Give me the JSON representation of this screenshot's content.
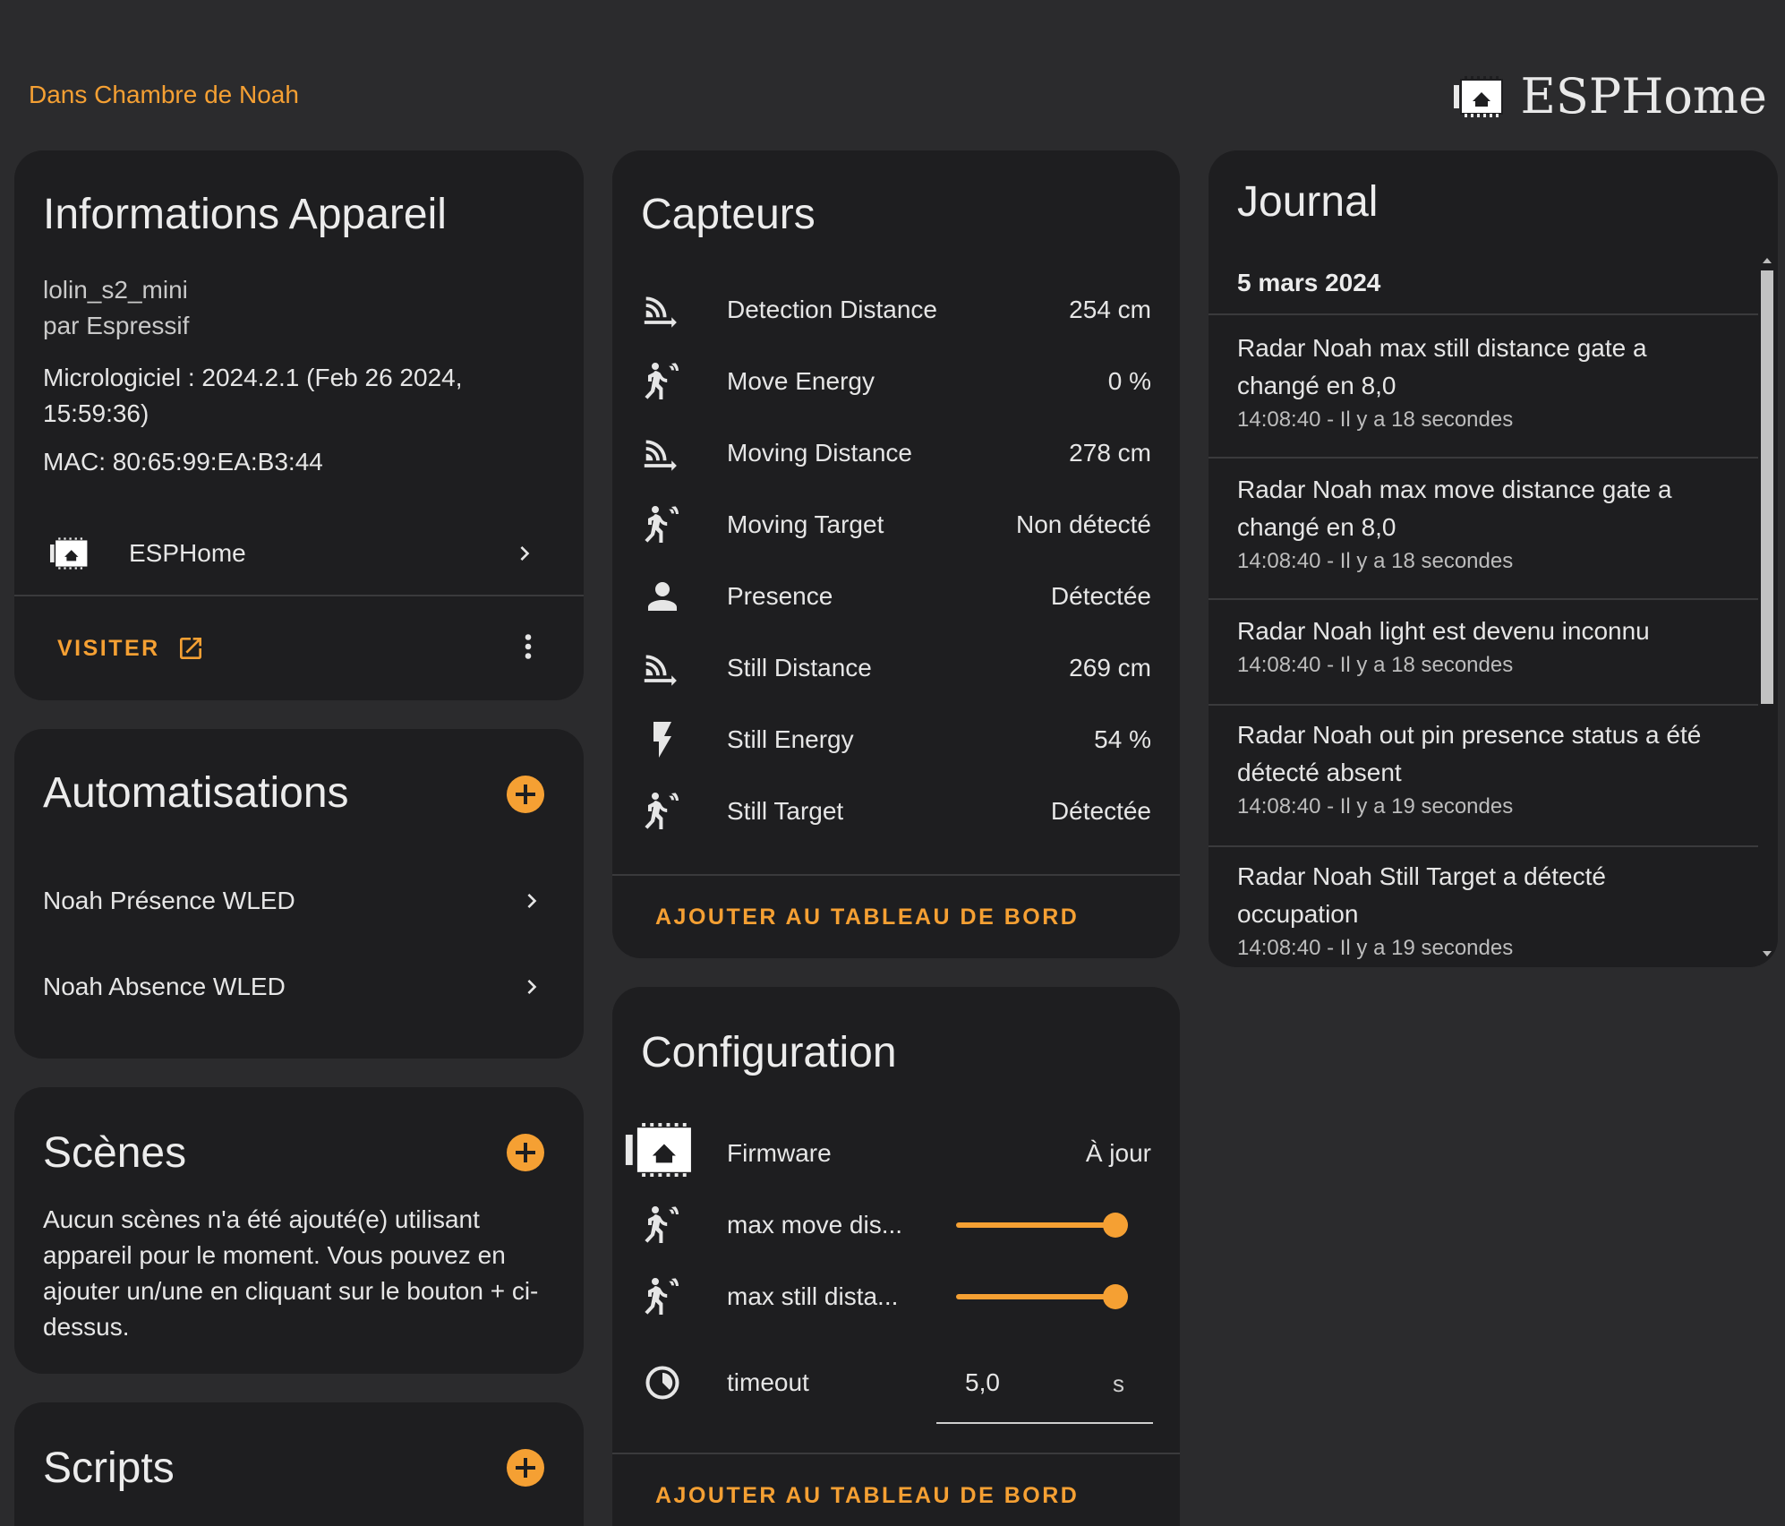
{
  "header": {
    "area": "Dans Chambre de Noah",
    "brand": "ESPHome"
  },
  "device_info": {
    "title": "Informations Appareil",
    "model": "lolin_s2_mini",
    "manufacturer": "par Espressif",
    "firmware_line1": "Micrologiciel : 2024.2.1 (Feb 26 2024,",
    "firmware_line2": "15:59:36)",
    "mac": "MAC: 80:65:99:EA:B3:44",
    "integration": "ESPHome",
    "visit": "VISITER"
  },
  "automations": {
    "title": "Automatisations",
    "items": [
      {
        "label": "Noah Présence WLED"
      },
      {
        "label": "Noah Absence WLED"
      }
    ]
  },
  "scenes": {
    "title": "Scènes",
    "empty_line1": "Aucun scènes n'a été ajouté(e) utilisant",
    "empty_line2": "appareil pour le moment. Vous pouvez en",
    "empty_line3": "ajouter un/une en cliquant sur le bouton + ci-",
    "empty_line4": "dessus."
  },
  "scripts": {
    "title": "Scripts"
  },
  "sensors": {
    "title": "Capteurs",
    "items": [
      {
        "label": "Detection Distance",
        "value": "254 cm",
        "icon": "signal-distance-icon"
      },
      {
        "label": "Move Energy",
        "value": "0 %",
        "icon": "motion-sensor-icon"
      },
      {
        "label": "Moving Distance",
        "value": "278 cm",
        "icon": "signal-distance-icon"
      },
      {
        "label": "Moving Target",
        "value": "Non détecté",
        "icon": "motion-sensor-icon"
      },
      {
        "label": "Presence",
        "value": "Détectée",
        "icon": "account-icon"
      },
      {
        "label": "Still Distance",
        "value": "269 cm",
        "icon": "signal-distance-icon"
      },
      {
        "label": "Still Energy",
        "value": "54 %",
        "icon": "lightning-icon"
      },
      {
        "label": "Still Target",
        "value": "Détectée",
        "icon": "motion-sensor-icon"
      }
    ],
    "add_button": "AJOUTER AU TABLEAU DE BORD"
  },
  "configuration": {
    "title": "Configuration",
    "firmware_label": "Firmware",
    "firmware_value": "À jour",
    "max_move_label": "max move dis...",
    "max_move_level": 1.0,
    "max_still_label": "max still dista...",
    "max_still_level": 1.0,
    "timeout_label": "timeout",
    "timeout_value": "5,0",
    "timeout_unit": "s",
    "add_button": "AJOUTER AU TABLEAU DE BORD"
  },
  "journal": {
    "title": "Journal",
    "date": "5 mars 2024",
    "entries": [
      {
        "line1": "Radar Noah max still distance gate a",
        "line2": "changé en 8,0",
        "time": "14:08:40 - Il y a 18 secondes"
      },
      {
        "line1": "Radar Noah max move distance gate a",
        "line2": "changé en 8,0",
        "time": "14:08:40 - Il y a 18 secondes"
      },
      {
        "line1": "Radar Noah light est devenu inconnu",
        "line2": "",
        "time": "14:08:40 - Il y a 18 secondes"
      },
      {
        "line1": "Radar Noah out pin presence status a été",
        "line2": "détecté absent",
        "time": "14:08:40 - Il y a 19 secondes"
      },
      {
        "line1": "Radar Noah Still Target a détecté",
        "line2": "occupation",
        "time": "14:08:40 - Il y a 19 secondes"
      }
    ]
  },
  "colors": {
    "accent": "#f5a033",
    "background": "#2b2b2d",
    "card": "#1e1e20"
  }
}
